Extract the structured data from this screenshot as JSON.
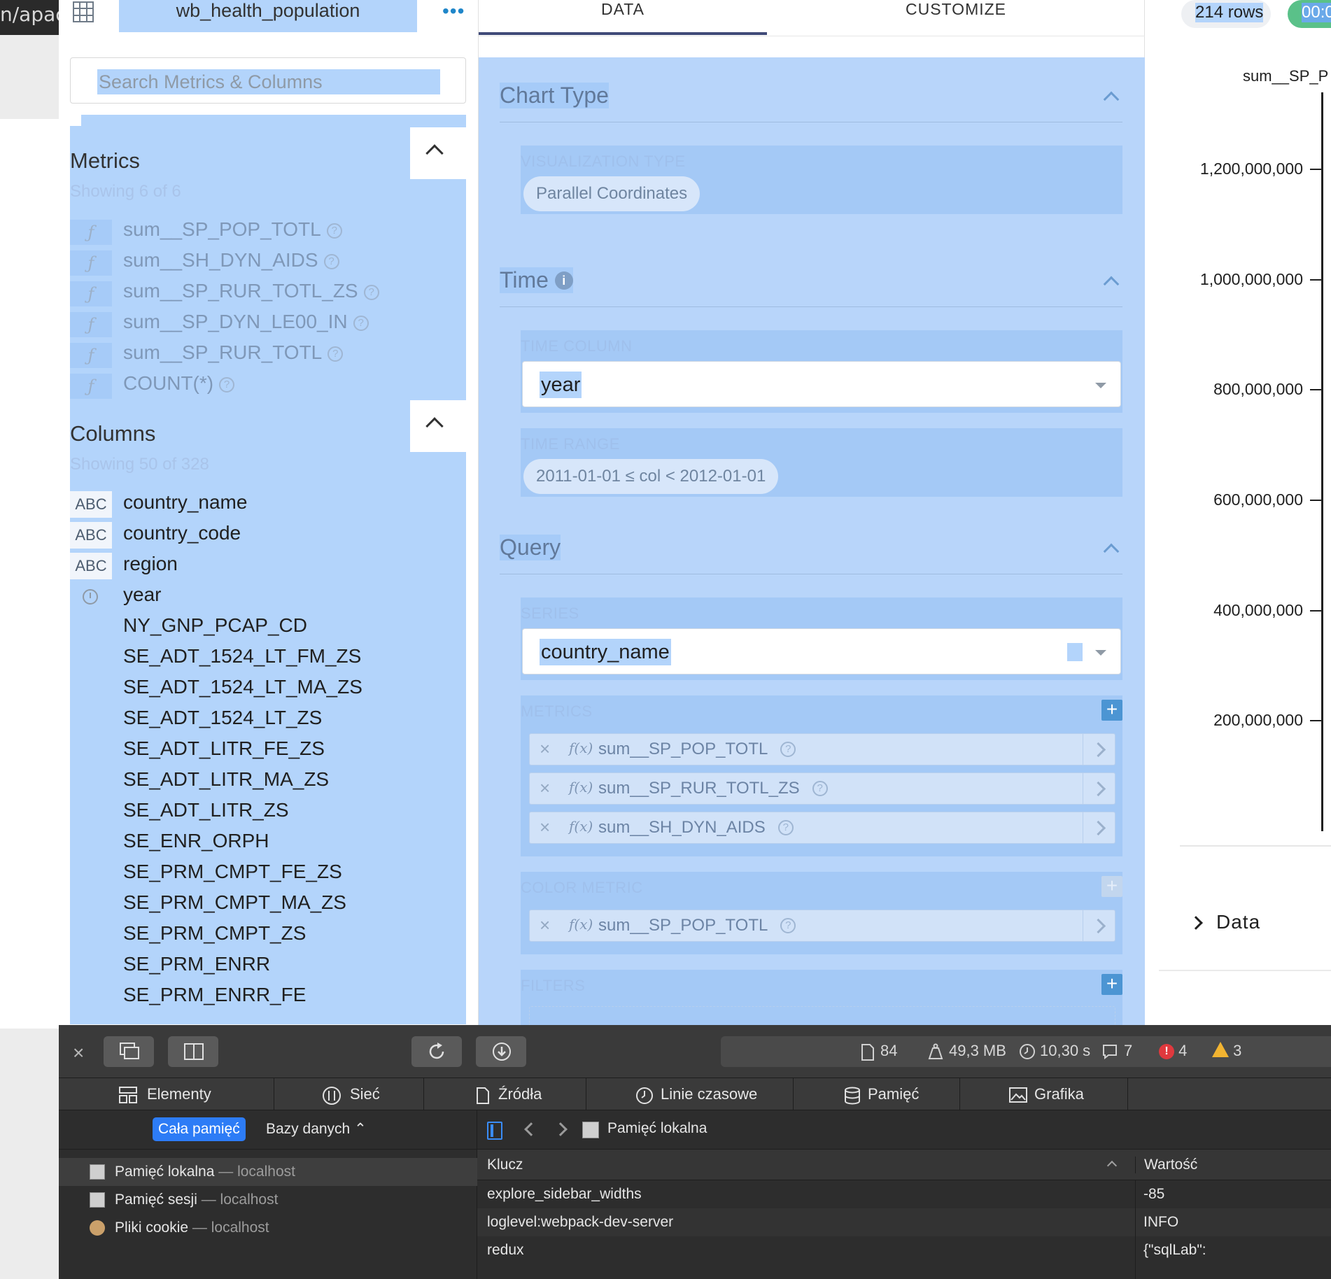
{
  "background_window": {
    "url_fragment": "n/apac"
  },
  "datasource": {
    "name": "wb_health_population",
    "menu_glyph": "•••",
    "search_placeholder": "Search Metrics & Columns",
    "metrics_title": "Metrics",
    "metrics_showing": "Showing 6 of 6",
    "metrics": [
      {
        "name": "sum__SP_POP_TOTL"
      },
      {
        "name": "sum__SH_DYN_AIDS"
      },
      {
        "name": "sum__SP_RUR_TOTL_ZS"
      },
      {
        "name": "sum__SP_DYN_LE00_IN"
      },
      {
        "name": "sum__SP_RUR_TOTL"
      },
      {
        "name": "COUNT(*)"
      }
    ],
    "metric_type_glyph": "ƒ",
    "columns_title": "Columns",
    "columns_showing": "Showing 50 of 328",
    "columns": [
      {
        "type": "ABC",
        "name": "country_name"
      },
      {
        "type": "ABC",
        "name": "country_code"
      },
      {
        "type": "ABC",
        "name": "region"
      },
      {
        "type": "time",
        "name": "year"
      },
      {
        "type": "",
        "name": "NY_GNP_PCAP_CD"
      },
      {
        "type": "",
        "name": "SE_ADT_1524_LT_FM_ZS"
      },
      {
        "type": "",
        "name": "SE_ADT_1524_LT_MA_ZS"
      },
      {
        "type": "",
        "name": "SE_ADT_1524_LT_ZS"
      },
      {
        "type": "",
        "name": "SE_ADT_LITR_FE_ZS"
      },
      {
        "type": "",
        "name": "SE_ADT_LITR_MA_ZS"
      },
      {
        "type": "",
        "name": "SE_ADT_LITR_ZS"
      },
      {
        "type": "",
        "name": "SE_ENR_ORPH"
      },
      {
        "type": "",
        "name": "SE_PRM_CMPT_FE_ZS"
      },
      {
        "type": "",
        "name": "SE_PRM_CMPT_MA_ZS"
      },
      {
        "type": "",
        "name": "SE_PRM_CMPT_ZS"
      },
      {
        "type": "",
        "name": "SE_PRM_ENRR"
      },
      {
        "type": "",
        "name": "SE_PRM_ENRR_FE"
      }
    ]
  },
  "controls": {
    "tabs": [
      {
        "label": "DATA"
      },
      {
        "label": "CUSTOMIZE"
      }
    ],
    "chart_type": {
      "title": "Chart Type",
      "viz_label": "VISUALIZATION TYPE",
      "viz_value": "Parallel Coordinates"
    },
    "time": {
      "title": "Time",
      "info_glyph": "i",
      "column_label": "TIME COLUMN",
      "column_value": "year",
      "range_label": "TIME RANGE",
      "range_value": "2011-01-01 ≤ col < 2012-01-01"
    },
    "query": {
      "title": "Query",
      "series_label": "SERIES",
      "series_value": "country_name",
      "metrics_label": "METRICS",
      "metrics": [
        {
          "name": "sum__SP_POP_TOTL"
        },
        {
          "name": "sum__SP_RUR_TOTL_ZS"
        },
        {
          "name": "sum__SH_DYN_AIDS"
        }
      ],
      "color_metric_label": "COLOR METRIC",
      "color_metric": {
        "name": "sum__SP_POP_TOTL"
      },
      "filters_label": "FILTERS",
      "remove_glyph": "×",
      "fx_glyph": "f(x)",
      "help_glyph": "?",
      "add_glyph": "+"
    }
  },
  "chart": {
    "row_count": "214 rows",
    "elapsed": "00:0",
    "data_toggle_label": "Data"
  },
  "chart_data": {
    "type": "line",
    "title": "",
    "axis_title": "sum__SP_P",
    "ylabel": "sum__SP_P",
    "xlabel": "",
    "ylim": [
      0,
      1200000000
    ],
    "ticks": [
      {
        "value": 1200000000,
        "label": "1,200,000,000"
      },
      {
        "value": 1000000000,
        "label": "1,000,000,000"
      },
      {
        "value": 800000000,
        "label": "800,000,000"
      },
      {
        "value": 600000000,
        "label": "600,000,000"
      },
      {
        "value": 400000000,
        "label": "400,000,000"
      },
      {
        "value": 200000000,
        "label": "200,000,000"
      }
    ],
    "grid": false,
    "legend": "none"
  },
  "devtools": {
    "close_glyph": "×",
    "status": {
      "resources": "84",
      "size": "49,3 MB",
      "time": "10,30 s",
      "logs": "7",
      "errors": "4",
      "error_glyph": "!",
      "warnings": "3"
    },
    "tabs": [
      {
        "label": "Elementy"
      },
      {
        "label": "Sieć"
      },
      {
        "label": "Źródła"
      },
      {
        "label": "Linie czasowe"
      },
      {
        "label": "Pamięć"
      },
      {
        "label": "Grafika"
      }
    ],
    "storage_scope_active": "Cała pamięć",
    "storage_scope_db": "Bazy danych ⌃",
    "storage_items": [
      {
        "label": "Pamięć lokalna",
        "host": "— localhost"
      },
      {
        "label": "Pamięć sesji",
        "host": "— localhost"
      },
      {
        "label": "Pliki cookie",
        "host": "— localhost"
      }
    ],
    "main_title": "Pamięć lokalna",
    "table": {
      "key_header": "Klucz",
      "value_header": "Wartość",
      "rows": [
        {
          "key": "explore_sidebar_widths",
          "value": "-85"
        },
        {
          "key": "loglevel:webpack-dev-server",
          "value": "INFO"
        },
        {
          "key": "redux",
          "value": "{\"sqlLab\":"
        }
      ]
    }
  }
}
